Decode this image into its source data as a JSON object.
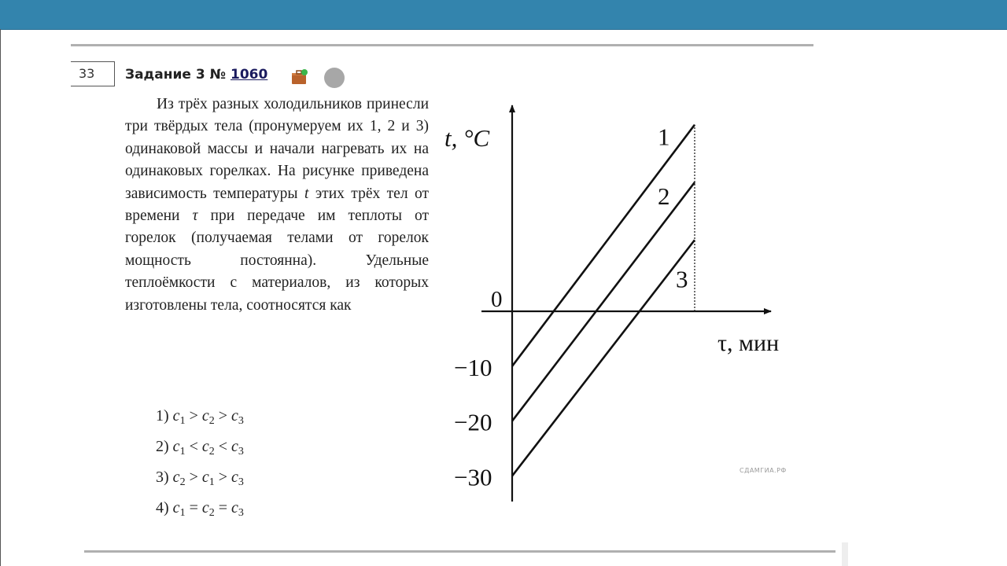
{
  "header": {
    "bar_color": "#3384ad"
  },
  "task": {
    "number_box": "33",
    "title_prefix": "Задание 3 № ",
    "task_id": "1060",
    "icons": [
      "briefcase-icon",
      "status-dot-icon"
    ]
  },
  "problem": {
    "text_before_t": "Из трёх разных холодильников принесли три твёрдых тела (пронумеруем их 1, 2 и 3) одинаковой массы и начали нагревать их на одинаковых горелках. На рисунке приведена зависимость температуры ",
    "var_t": "t",
    "text_mid": " этих трёх тел от времени ",
    "var_tau": "τ",
    "text_after": " при передаче им теплоты от горелок (получаемая телами от горелок мощность постоянна). Удельные теплоёмкости ",
    "var_c": "c",
    "text_end": " материалов, из которых изготовлены тела, соотносятся как"
  },
  "options": [
    {
      "num": "1)",
      "a": "c",
      "as": "1",
      "op1": " > ",
      "b": "c",
      "bs": "2",
      "op2": " > ",
      "c": "c",
      "cs": "3"
    },
    {
      "num": "2)",
      "a": "c",
      "as": "1",
      "op1": " < ",
      "b": "c",
      "bs": "2",
      "op2": " < ",
      "c": "c",
      "cs": "3"
    },
    {
      "num": "3)",
      "a": "c",
      "as": "2",
      "op1": " > ",
      "b": "c",
      "bs": "1",
      "op2": " > ",
      "c": "c",
      "cs": "3"
    },
    {
      "num": "4)",
      "a": "c",
      "as": "1",
      "op1": " = ",
      "b": "c",
      "bs": "2",
      "op2": " = ",
      "c": "c",
      "cs": "3"
    }
  ],
  "watermark": "СДАМГИА.РФ",
  "chart_data": {
    "type": "line",
    "title": "",
    "xlabel": "τ, мин",
    "ylabel": "t, °C",
    "origin_label": "0",
    "y_ticks": [
      -10,
      -20,
      -30
    ],
    "y_tick_labels": [
      "−10",
      "−20",
      "−30"
    ],
    "x_ticks": [],
    "xlim": [
      0,
      1.4
    ],
    "ylim": [
      -34,
      40
    ],
    "grid": false,
    "legend": "inline labels at line ends",
    "series": [
      {
        "name": "1",
        "x": [
          0,
          1
        ],
        "y": [
          -10,
          34
        ]
      },
      {
        "name": "2",
        "x": [
          0,
          1
        ],
        "y": [
          -20,
          23.5
        ]
      },
      {
        "name": "3",
        "x": [
          0,
          1
        ],
        "y": [
          -30,
          13
        ]
      }
    ],
    "annotations": [
      {
        "type": "dashed-vertical",
        "x": 1,
        "from_y": 0,
        "to_y": 34,
        "text": ""
      }
    ]
  }
}
